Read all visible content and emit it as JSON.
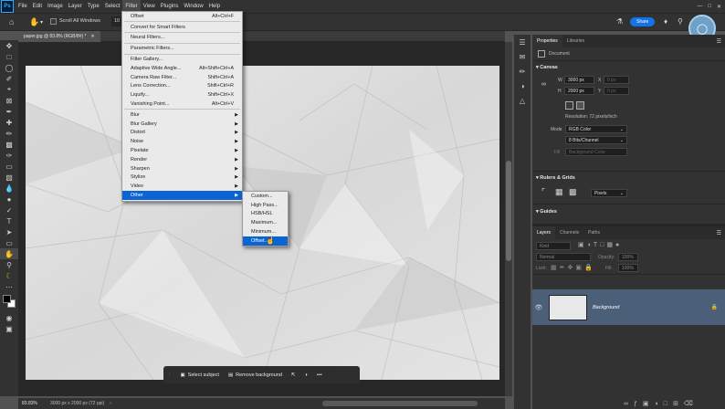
{
  "app": {
    "logo": "Ps"
  },
  "menubar": [
    "File",
    "Edit",
    "Image",
    "Layer",
    "Type",
    "Select",
    "Filter",
    "View",
    "Plugins",
    "Window",
    "Help"
  ],
  "options": {
    "scroll_all": "Scroll All Windows",
    "share": "Share",
    "zoom_partial": "10"
  },
  "document": {
    "tab": "paper.jpg @ 83.8% (RGB/8#) *",
    "zoom": "83.83%",
    "info": "3000 px x 2000 px (72 ppi)"
  },
  "filter_menu": {
    "items": [
      {
        "label": "Offset",
        "shortcut": "Alt+Ctrl+F"
      },
      {
        "sep": true
      },
      {
        "label": "Convert for Smart Filters"
      },
      {
        "sep": true
      },
      {
        "label": "Neural Filters..."
      },
      {
        "sep": true
      },
      {
        "label": "Parametric Filters..."
      },
      {
        "sep": true
      },
      {
        "label": "Filter Gallery..."
      },
      {
        "label": "Adaptive Wide Angle...",
        "shortcut": "Alt+Shift+Ctrl+A"
      },
      {
        "label": "Camera Raw Filter...",
        "shortcut": "Shift+Ctrl+A"
      },
      {
        "label": "Lens Correction...",
        "shortcut": "Shift+Ctrl+R"
      },
      {
        "label": "Liquify...",
        "shortcut": "Shift+Ctrl+X"
      },
      {
        "label": "Vanishing Point...",
        "shortcut": "Alt+Ctrl+V"
      },
      {
        "sep": true
      },
      {
        "label": "Blur",
        "sub": true
      },
      {
        "label": "Blur Gallery",
        "sub": true
      },
      {
        "label": "Distort",
        "sub": true
      },
      {
        "label": "Noise",
        "sub": true
      },
      {
        "label": "Pixelate",
        "sub": true
      },
      {
        "label": "Render",
        "sub": true
      },
      {
        "label": "Sharpen",
        "sub": true
      },
      {
        "label": "Stylize",
        "sub": true
      },
      {
        "label": "Video",
        "sub": true
      },
      {
        "label": "Other",
        "sub": true,
        "highlighted": true
      }
    ]
  },
  "other_submenu": {
    "items": [
      {
        "label": "Custom..."
      },
      {
        "label": "High Pass..."
      },
      {
        "label": "HSB/HSL"
      },
      {
        "label": "Maximum..."
      },
      {
        "label": "Minimum..."
      },
      {
        "label": "Offset...",
        "highlighted": true
      }
    ]
  },
  "context_bar": {
    "select_subject": "Select subject",
    "remove_background": "Remove background",
    "more": "•••"
  },
  "properties": {
    "tabs": [
      "Properties",
      "Libraries"
    ],
    "doc_label": "Document",
    "canvas_title": "Canvas",
    "w_label": "W",
    "w_value": "3000 px",
    "x_label": "X",
    "x_value": "0 px",
    "h_label": "H",
    "h_value": "2000 px",
    "y_label": "Y",
    "y_value": "0 px",
    "resolution": "Resolution: 72 pixels/inch",
    "mode_label": "Mode",
    "mode_value": "RGB Color",
    "bits_value": "8 Bits/Channel",
    "fill_label": "Fill",
    "fill_value": "Background Color",
    "rulers_title": "Rulers & Grids",
    "units_value": "Pixels",
    "guides_title": "Guides"
  },
  "layers": {
    "tabs": [
      "Layers",
      "Channels",
      "Paths"
    ],
    "kind_placeholder": "Kind",
    "blend_mode": "Normal",
    "opacity_label": "Opacity:",
    "opacity_value": "100%",
    "lock_label": "Lock:",
    "fill_label": "Fill:",
    "fill_value": "100%",
    "layer_name": "Background"
  },
  "colors": {
    "accent": "#1473e6",
    "menu_highlight": "#0a64d4",
    "layer_selected": "#4b5f79"
  }
}
